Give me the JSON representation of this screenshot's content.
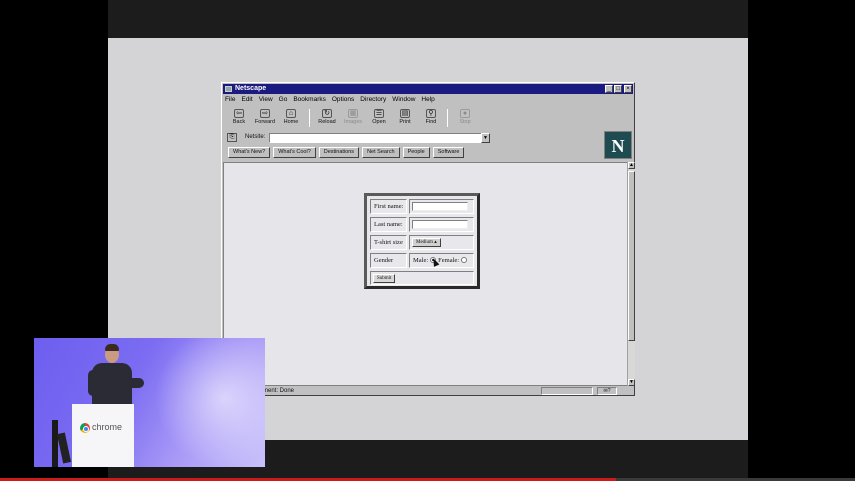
{
  "netscape": {
    "title": "Netscape",
    "menu": [
      "File",
      "Edit",
      "View",
      "Go",
      "Bookmarks",
      "Options",
      "Directory",
      "Window",
      "Help"
    ],
    "toolbar": [
      {
        "label": "Back",
        "glyph": "⇦",
        "enabled": true
      },
      {
        "label": "Forward",
        "glyph": "⇨",
        "enabled": true
      },
      {
        "label": "Home",
        "glyph": "⌂",
        "enabled": true
      },
      {
        "label": "Reload",
        "glyph": "↻",
        "enabled": true
      },
      {
        "label": "Images",
        "glyph": "▦",
        "enabled": false
      },
      {
        "label": "Open",
        "glyph": "☰",
        "enabled": true
      },
      {
        "label": "Print",
        "glyph": "▤",
        "enabled": true
      },
      {
        "label": "Find",
        "glyph": "⚲",
        "enabled": true
      },
      {
        "label": "Stop",
        "glyph": "●",
        "enabled": false
      }
    ],
    "location_label": "Netsite:",
    "location_value": "",
    "directory_buttons": [
      "What's New?",
      "What's Cool?",
      "Destinations",
      "Net Search",
      "People",
      "Software"
    ],
    "logo_letter": "N",
    "status_text": "ment: Done"
  },
  "form": {
    "first_name_label": "First name:",
    "last_name_label": "Last name:",
    "size_label": "T-shirt size",
    "size_value": "Medium",
    "gender_label": "Gender",
    "male_label": "Male:",
    "female_label": "Female:",
    "selected_gender": "male",
    "submit_label": "Submit"
  },
  "inset": {
    "brand": "chrome"
  },
  "video": {
    "progress_fraction": 0.72
  },
  "colors": {
    "titlebar": "#1a1a80",
    "window_face": "#c0c0c0",
    "inset_accent": "#6e5ef0",
    "progress": "#cc1a1a"
  }
}
